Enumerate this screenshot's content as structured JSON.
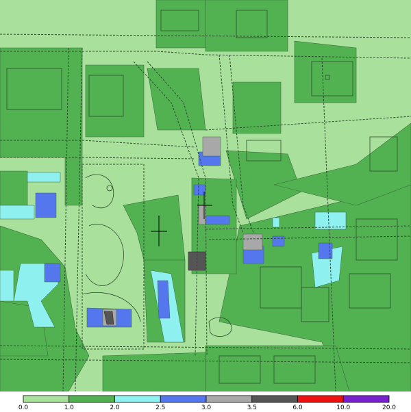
{
  "legend": {
    "colors": [
      "#a8e09c",
      "#52b252",
      "#8ff0f0",
      "#5577ee",
      "#a8a8a8",
      "#555555",
      "#ee1111",
      "#7722cc"
    ],
    "labels": [
      "0.0",
      "1.0",
      "2.0",
      "2.5",
      "3.0",
      "3.5",
      "6.0",
      "10.0",
      "20.0"
    ]
  },
  "palette": {
    "light_green": "#a8e09c",
    "dark_green": "#52b252",
    "cyan": "#8ff0f0",
    "blue": "#5577ee",
    "grey": "#a8a8a8",
    "dark_grey": "#555555",
    "road_outline": "#3a5a3a"
  }
}
